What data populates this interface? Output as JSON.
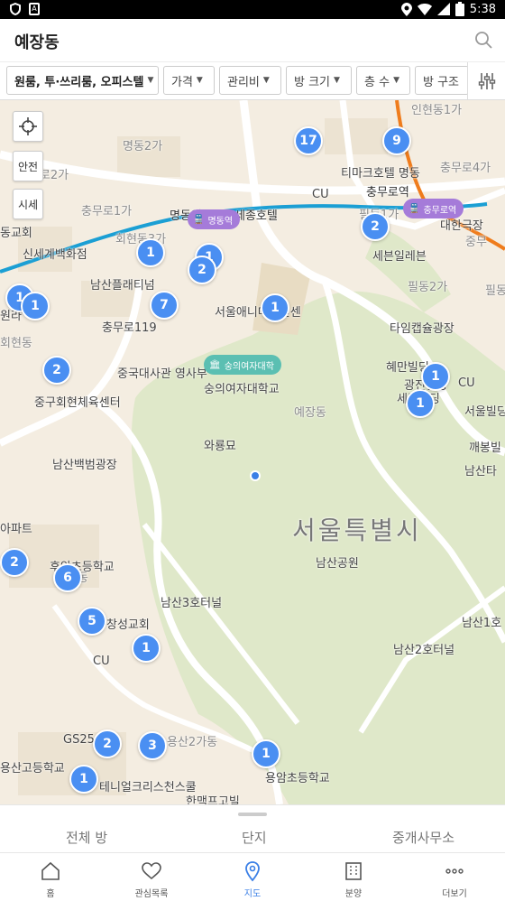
{
  "status_bar": {
    "time": "5:38"
  },
  "header": {
    "title": "예장동"
  },
  "filters": [
    {
      "label": "원룸, 투·쓰리룸, 오피스텔",
      "strong": true
    },
    {
      "label": "가격"
    },
    {
      "label": "관리비"
    },
    {
      "label": "방 크기"
    },
    {
      "label": "층 수"
    },
    {
      "label": "방 구조"
    }
  ],
  "map_controls": {
    "safety": "안전",
    "price": "시세"
  },
  "map_labels": [
    {
      "text": "명동2가",
      "cls": "light"
    },
    {
      "text": "충무로2가",
      "cls": "light"
    },
    {
      "text": "충무로1가",
      "cls": "light"
    },
    {
      "text": "동교회",
      "cls": ""
    },
    {
      "text": "신세계백화점",
      "cls": ""
    },
    {
      "text": "회현동3가",
      "cls": "light"
    },
    {
      "text": "남산플래티넘",
      "cls": ""
    },
    {
      "text": "충무로119",
      "cls": ""
    },
    {
      "text": "서울애니메이션센",
      "cls": ""
    },
    {
      "text": "회현동",
      "cls": "light"
    },
    {
      "text": "원라",
      "cls": ""
    },
    {
      "text": "중국대사관 영사부",
      "cls": ""
    },
    {
      "text": "숭의여자대학교",
      "cls": ""
    },
    {
      "text": "중구회현체육센터",
      "cls": ""
    },
    {
      "text": "와룡묘",
      "cls": ""
    },
    {
      "text": "예장동",
      "cls": "light"
    },
    {
      "text": "남산백범광장",
      "cls": ""
    },
    {
      "text": "서울특별시",
      "cls": "big"
    },
    {
      "text": "남산공원",
      "cls": ""
    },
    {
      "text": "아파트",
      "cls": ""
    },
    {
      "text": "후암초등학교",
      "cls": ""
    },
    {
      "text": "후암동",
      "cls": "light"
    },
    {
      "text": "남산3호터널",
      "cls": ""
    },
    {
      "text": "창성교회",
      "cls": ""
    },
    {
      "text": "CU",
      "cls": ""
    },
    {
      "text": "남산1호",
      "cls": ""
    },
    {
      "text": "남산2호터널",
      "cls": ""
    },
    {
      "text": "GS25",
      "cls": ""
    },
    {
      "text": "용산고등학교",
      "cls": ""
    },
    {
      "text": "용산2가동",
      "cls": "light"
    },
    {
      "text": "테니얼크리스천스쿨",
      "cls": ""
    },
    {
      "text": "용암초등학교",
      "cls": ""
    },
    {
      "text": "명동역",
      "cls": "dark"
    },
    {
      "text": "세종호텔",
      "cls": "dark"
    },
    {
      "text": "CU",
      "cls": ""
    },
    {
      "text": "티마크호텔 명동",
      "cls": ""
    },
    {
      "text": "충무로역",
      "cls": "dark"
    },
    {
      "text": "충무로4가",
      "cls": "light"
    },
    {
      "text": "필동1가",
      "cls": "light"
    },
    {
      "text": "대한극장",
      "cls": ""
    },
    {
      "text": "세븐일레븐",
      "cls": ""
    },
    {
      "text": "필동2가",
      "cls": "light"
    },
    {
      "text": "필동",
      "cls": "light"
    },
    {
      "text": "타임캡슐광장",
      "cls": ""
    },
    {
      "text": "혜만빌딩",
      "cls": ""
    },
    {
      "text": "광진빌딩",
      "cls": ""
    },
    {
      "text": "세경빌딩",
      "cls": ""
    },
    {
      "text": "CU",
      "cls": ""
    },
    {
      "text": "서울빌딩",
      "cls": ""
    },
    {
      "text": "깨봉빌",
      "cls": ""
    },
    {
      "text": "남산타",
      "cls": ""
    },
    {
      "text": "한맥프고빌",
      "cls": ""
    },
    {
      "text": "중무",
      "cls": "light"
    },
    {
      "text": "인현동1가",
      "cls": "light"
    }
  ],
  "stations": [
    {
      "text": "명동역"
    },
    {
      "text": "충무로역"
    }
  ],
  "poi_badge": {
    "text": "숭의여자대학"
  },
  "pins": [
    {
      "count": "17"
    },
    {
      "count": "9"
    },
    {
      "count": "2"
    },
    {
      "count": "1"
    },
    {
      "count": "1"
    },
    {
      "count": "2"
    },
    {
      "count": "1"
    },
    {
      "count": "1"
    },
    {
      "count": "7"
    },
    {
      "count": "1"
    },
    {
      "count": "2"
    },
    {
      "count": "1"
    },
    {
      "count": "1"
    },
    {
      "count": "2"
    },
    {
      "count": "6"
    },
    {
      "count": "5"
    },
    {
      "count": "1"
    },
    {
      "count": "2"
    },
    {
      "count": "3"
    },
    {
      "count": "1"
    },
    {
      "count": "1"
    }
  ],
  "sheet_tabs": [
    {
      "label": "전체 방"
    },
    {
      "label": "단지"
    },
    {
      "label": "중개사무소"
    }
  ],
  "bottom_nav": [
    {
      "label": "홈",
      "icon": "home-icon"
    },
    {
      "label": "관심목록",
      "icon": "heart-icon"
    },
    {
      "label": "지도",
      "icon": "map-pin-icon",
      "active": true
    },
    {
      "label": "분양",
      "icon": "building-icon"
    },
    {
      "label": "더보기",
      "icon": "more-icon"
    }
  ],
  "colors": {
    "accent": "#3a7fe6",
    "pin": "#4a8ff2",
    "subway_line4": "#1b9fd4",
    "subway_line3": "#ef7c1c",
    "park": "#dfe8c9"
  }
}
